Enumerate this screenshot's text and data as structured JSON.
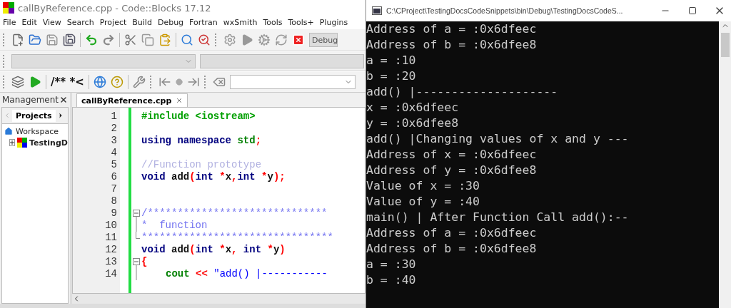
{
  "ide": {
    "title": "callByReference.cpp - Code::Blocks 17.12",
    "menu": [
      "File",
      "Edit",
      "View",
      "Search",
      "Project",
      "Build",
      "Debug",
      "Fortran",
      "wxSmith",
      "Tools",
      "Tools+",
      "Plugins"
    ],
    "build_target": "Debug",
    "doxygen_label": "/** *<",
    "management": {
      "title": "Management",
      "tabs": [
        {
          "label": "Projects",
          "selected": true
        }
      ],
      "tree": [
        {
          "label": "Workspace",
          "kind": "workspace",
          "children": [
            {
              "label": "TestingD",
              "kind": "project",
              "expanded": false
            }
          ]
        }
      ]
    },
    "editor": {
      "tabs": [
        {
          "label": "callByReference.cpp",
          "selected": true
        }
      ],
      "lines": [
        {
          "number": "1",
          "tokens": [
            {
              "text": "#include <iostream>",
              "kind": "pre"
            }
          ]
        },
        {
          "number": "2"
        },
        {
          "number": "3",
          "tokens": [
            {
              "text": "using namespace",
              "kind": "kw"
            },
            {
              "text": " std",
              "kind": "lib"
            },
            {
              "text": ";",
              "kind": "op"
            }
          ]
        },
        {
          "number": "4"
        },
        {
          "number": "5",
          "tokens": [
            {
              "text": "//Function prototype",
              "kind": "cm"
            }
          ]
        },
        {
          "number": "6",
          "tokens": [
            {
              "text": "void",
              "kind": "kw"
            },
            {
              "text": " add",
              "kind": "plain"
            },
            {
              "text": "(",
              "kind": "op"
            },
            {
              "text": "int",
              "kind": "kw"
            },
            {
              "text": " *",
              "kind": "op"
            },
            {
              "text": "x",
              "kind": "plain"
            },
            {
              "text": ",",
              "kind": "op"
            },
            {
              "text": "int",
              "kind": "kw"
            },
            {
              "text": " *",
              "kind": "op"
            },
            {
              "text": "y",
              "kind": "plain"
            },
            {
              "text": ");",
              "kind": "op"
            }
          ]
        },
        {
          "number": "7"
        },
        {
          "number": "8"
        },
        {
          "number": "9",
          "fold_start": true,
          "tokens": [
            {
              "text": "/******************************",
              "kind": "doc"
            }
          ]
        },
        {
          "number": "10",
          "in_fold": true,
          "tokens": [
            {
              "text": "*  function",
              "kind": "doc"
            }
          ]
        },
        {
          "number": "11",
          "fold_end": true,
          "tokens": [
            {
              "text": "********************************",
              "kind": "doc"
            }
          ]
        },
        {
          "number": "12",
          "tokens": [
            {
              "text": "void",
              "kind": "kw"
            },
            {
              "text": " add",
              "kind": "plain"
            },
            {
              "text": "(",
              "kind": "op"
            },
            {
              "text": "int",
              "kind": "kw"
            },
            {
              "text": " *",
              "kind": "op"
            },
            {
              "text": "x",
              "kind": "plain"
            },
            {
              "text": ",",
              "kind": "op"
            },
            {
              "text": " int",
              "kind": "kw"
            },
            {
              "text": " *",
              "kind": "op"
            },
            {
              "text": "y",
              "kind": "plain"
            },
            {
              "text": ")",
              "kind": "op"
            }
          ]
        },
        {
          "number": "13",
          "fold_start": true,
          "tokens": [
            {
              "text": "{",
              "kind": "op"
            }
          ]
        },
        {
          "number": "14",
          "in_fold": true,
          "indented": true,
          "tokens": [
            {
              "text": "cout",
              "kind": "lib"
            },
            {
              "text": " <<",
              "kind": "op"
            },
            {
              "text": " \"add() |-----------",
              "kind": "str"
            }
          ]
        }
      ]
    }
  },
  "console": {
    "title": "C:\\CProject\\TestingDocsCodeSnippets\\bin\\Debug\\TestingDocsCodeS...",
    "lines": [
      "Address of a = :0x6dfeec",
      "Address of b = :0x6dfee8",
      "a = :10",
      "b = :20",
      "add() |--------------------",
      "x = :0x6dfeec",
      "y = :0x6dfee8",
      "add() |Changing values of x and y ---",
      "Address of x = :0x6dfeec",
      "Address of y = :0x6dfee8",
      "Value of x = :30",
      "Value of y = :40",
      "main() | After Function Call add():--",
      "Address of a = :0x6dfeec",
      "Address of b = :0x6dfee8",
      "a = :30",
      "b = :40"
    ]
  }
}
